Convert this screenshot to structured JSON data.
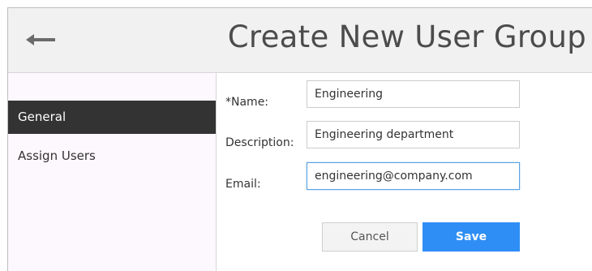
{
  "header": {
    "title": "Create New User Group",
    "back_icon": "arrow-left-icon"
  },
  "sidebar": {
    "items": [
      {
        "label": "General",
        "active": true
      },
      {
        "label": "Assign Users",
        "active": false
      }
    ]
  },
  "form": {
    "name_label": "*Name:",
    "name_value": "Engineering",
    "description_label": "Description:",
    "description_value": "Engineering department",
    "email_label": "Email:",
    "email_value": "engineering@company.com"
  },
  "actions": {
    "cancel_label": "Cancel",
    "save_label": "Save"
  },
  "colors": {
    "header_bg": "#f1f1f1",
    "sidebar_bg": "#fdf8fd",
    "active_item_bg": "#333333",
    "primary": "#2f8ef5",
    "focus_border": "#5aa1e3"
  }
}
